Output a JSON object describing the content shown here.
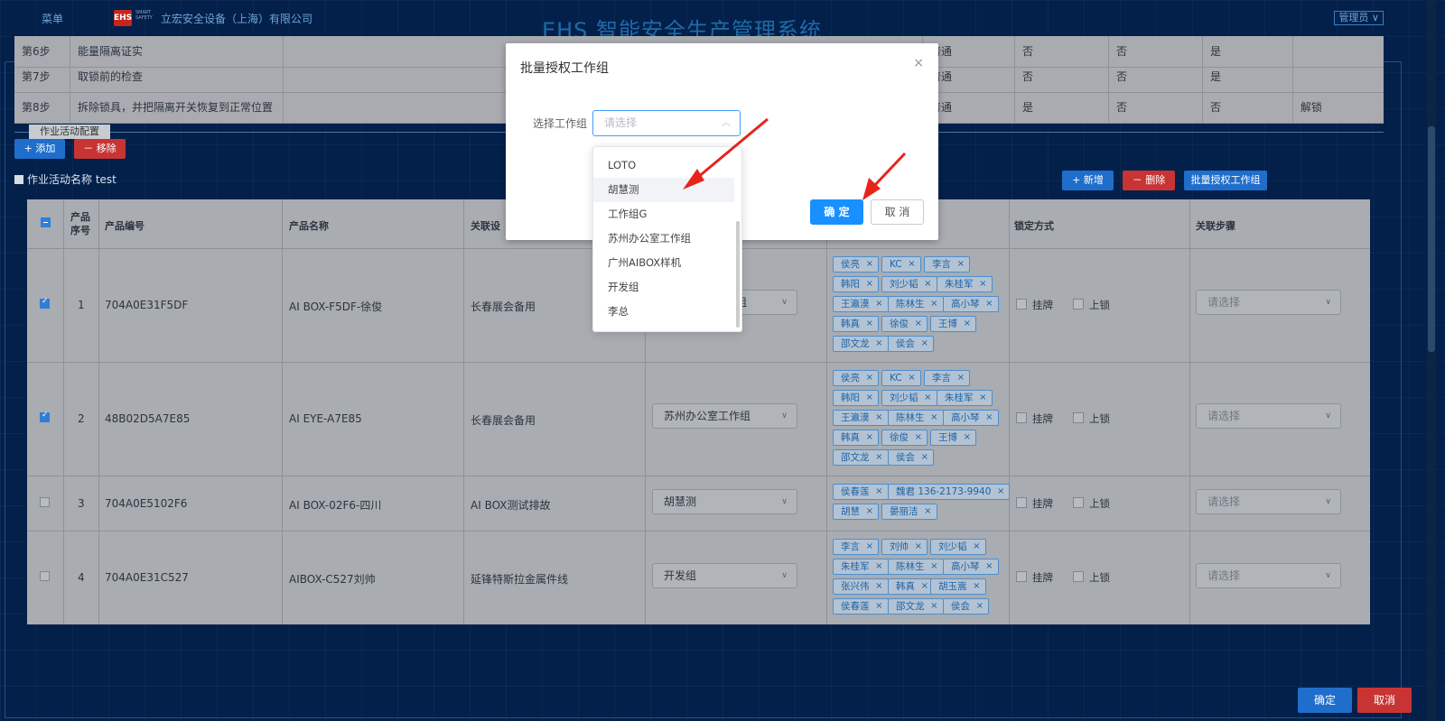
{
  "header": {
    "menu_label": "菜单",
    "logo_text": "EHS",
    "logo_sub": "SMART SAFETY",
    "company": "立宏安全设备（上海）有限公司",
    "system_title": "EHS 智能安全生产管理系统",
    "admin_label": "管理员 ∨"
  },
  "steps": [
    {
      "step": "第6步",
      "desc": "能量隔离证实",
      "c1": "普通",
      "c2": "否",
      "c3": "否",
      "c4": "是",
      "c5": ""
    },
    {
      "step": "第7步",
      "desc": "取锁前的检查",
      "c1": "普通",
      "c2": "否",
      "c3": "否",
      "c4": "是",
      "c5": ""
    },
    {
      "step": "第8步",
      "desc": "拆除锁具，并把隔离开关恢复到正常位置",
      "c1": "普通",
      "c2": "是",
      "c3": "否",
      "c4": "否",
      "c5": "解锁"
    }
  ],
  "activity": {
    "tab_label": "作业活动配置",
    "add_label": "+ 添加",
    "remove_label": "－ 移除",
    "name_label": "作业活动名称 test",
    "new_label": "+ 新增",
    "delete_label": "－ 删除",
    "batch_label": "批量授权工作组"
  },
  "table": {
    "headers": {
      "seq": "产品序号",
      "code": "产品编号",
      "name": "产品名称",
      "rel": "关联设",
      "lock_mode": "锁定方式",
      "rel_step": "关联步骤"
    },
    "rows": [
      {
        "checked": true,
        "seq": "1",
        "code": "704A0E31F5DF",
        "name": "AI BOX-F5DF-徐俊",
        "rel": "长春展会备用",
        "group": "作组",
        "tags": [
          "侯亮",
          "KC",
          "李言",
          "韩阳",
          "刘少韬",
          "朱桂军",
          "王瀛漠",
          "陈林生",
          "高小琴",
          "韩真",
          "徐俊",
          "王博",
          "邵文龙",
          "侯会"
        ]
      },
      {
        "checked": true,
        "seq": "2",
        "code": "48B02D5A7E85",
        "name": "AI EYE-A7E85",
        "rel": "长春展会备用",
        "group": "苏州办公室工作组",
        "tags": [
          "侯亮",
          "KC",
          "李言",
          "韩阳",
          "刘少韬",
          "朱桂军",
          "王瀛漠",
          "陈林生",
          "高小琴",
          "韩真",
          "徐俊",
          "王博",
          "邵文龙",
          "侯会"
        ]
      },
      {
        "checked": false,
        "seq": "3",
        "code": "704A0E5102F6",
        "name": "AI BOX-02F6-四川",
        "rel": "AI BOX测试排故",
        "group": "胡慧测",
        "tags": [
          "侯春莲",
          "魏君 136-2173-9940",
          "胡慧",
          "晏丽洁"
        ]
      },
      {
        "checked": false,
        "seq": "4",
        "code": "704A0E31C527",
        "name": "AIBOX-C527刘帅",
        "rel": "延锋特斯拉金属件线",
        "group": "开发组",
        "tags": [
          "李言",
          "刘帅",
          "刘少韬",
          "朱桂军",
          "陈林生",
          "高小琴",
          "张兴伟",
          "韩真",
          "胡玉嵩",
          "侯春莲",
          "邵文龙",
          "侯会"
        ]
      }
    ],
    "lock_hang": "挂牌",
    "lock_lock": "上锁",
    "step_placeholder": "请选择"
  },
  "modal": {
    "title": "批量授权工作组",
    "close": "×",
    "field_label": "选择工作组",
    "placeholder": "请选择",
    "ok": "确 定",
    "cancel": "取 消"
  },
  "dropdown": {
    "options": [
      "LOTO",
      "胡慧测",
      "工作组G",
      "苏州办公室工作组",
      "广州AIBOX样机",
      "开发组",
      "李总"
    ],
    "hovered": "胡慧测"
  },
  "footer": {
    "ok": "确定",
    "cancel": "取消"
  },
  "colors": {
    "page_bg": "#03204a",
    "primary": "#1890ff",
    "danger": "#c83434",
    "annotation_arrow": "#e8231c"
  }
}
